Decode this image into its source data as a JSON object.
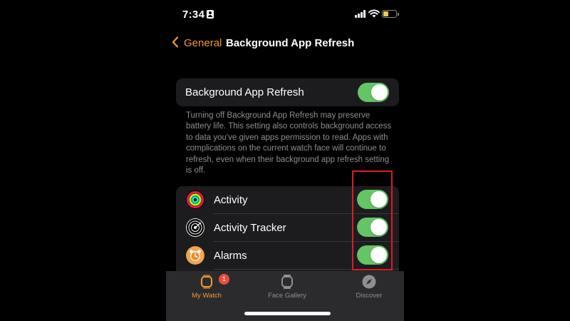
{
  "status_bar": {
    "time": "7:34",
    "icons": [
      "person-icon",
      "signal-icon",
      "wifi-icon",
      "battery-icon"
    ],
    "battery_color": "#f6c84c"
  },
  "nav": {
    "back_label": "General",
    "title": "Background App Refresh",
    "accent": "#f09a36"
  },
  "main_toggle": {
    "label": "Background App Refresh",
    "on": true
  },
  "footnote": "Turning off Background App Refresh may preserve battery life. This setting also controls background access to data you've given apps permission to read. Apps with complications on the current watch face will continue to refresh, even when their background app refresh setting is off.",
  "apps": [
    {
      "name": "Activity",
      "icon": "activity-rings-icon",
      "on": true
    },
    {
      "name": "Activity Tracker",
      "icon": "activity-tracker-icon",
      "on": true
    },
    {
      "name": "Alarms",
      "icon": "alarm-clock-icon",
      "on": true
    }
  ],
  "tab_bar": {
    "tabs": [
      {
        "label": "My Watch",
        "icon": "watch-icon",
        "active": true,
        "badge": "1"
      },
      {
        "label": "Face Gallery",
        "icon": "face-gallery-icon",
        "active": false
      },
      {
        "label": "Discover",
        "icon": "compass-icon",
        "active": false
      }
    ],
    "active_color": "#f09a36",
    "inactive_color": "#8e8e93"
  },
  "colors": {
    "toggle_on": "#65c466",
    "highlight": "#e01b24"
  }
}
